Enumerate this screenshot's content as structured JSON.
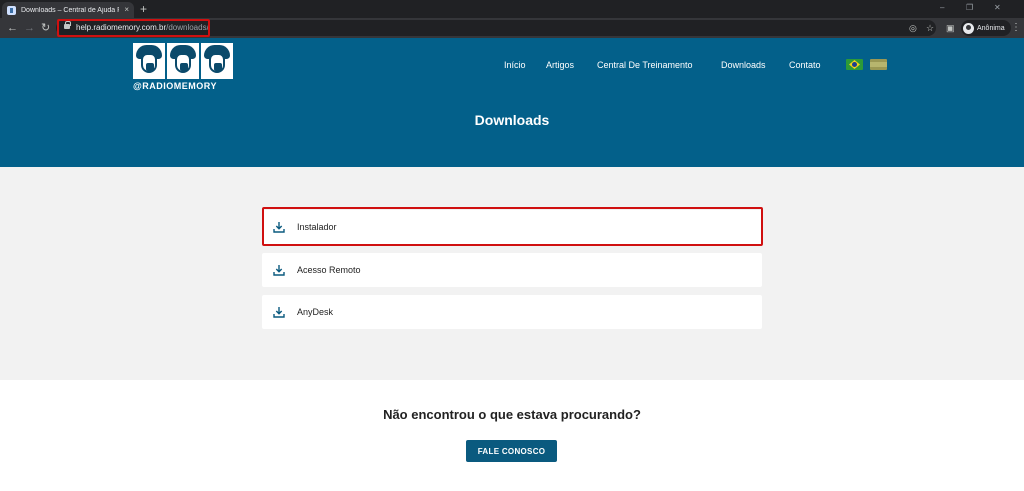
{
  "browser": {
    "tab_title": "Downloads – Central de Ajuda R",
    "tab_close": "×",
    "new_tab": "+",
    "url_host": "help.radiomemory.com.br",
    "url_path": "/downloads/",
    "profile_label": "Anônima",
    "window_controls": [
      "–",
      "❐",
      "✕"
    ]
  },
  "site": {
    "logo_text": "@RADIOMEMORY",
    "nav": [
      "Início",
      "Artigos",
      "Central De Treinamento",
      "Downloads",
      "Contato"
    ],
    "languages": [
      "pt-BR",
      "es"
    ],
    "page_title": "Downloads"
  },
  "downloads": {
    "items": [
      {
        "label": "Instalador",
        "icon": "download-icon",
        "highlighted": true
      },
      {
        "label": "Acesso Remoto",
        "icon": "download-icon",
        "highlighted": false
      },
      {
        "label": "AnyDesk",
        "icon": "download-icon",
        "highlighted": false
      }
    ]
  },
  "help": {
    "heading": "Não encontrou o que estava procurando?",
    "button_label": "FALE CONOSCO"
  },
  "colors": {
    "header_bg": "#03608a",
    "button_bg": "#0a5a7f",
    "icon": "#0a5a7f",
    "highlight": "#d01010"
  }
}
